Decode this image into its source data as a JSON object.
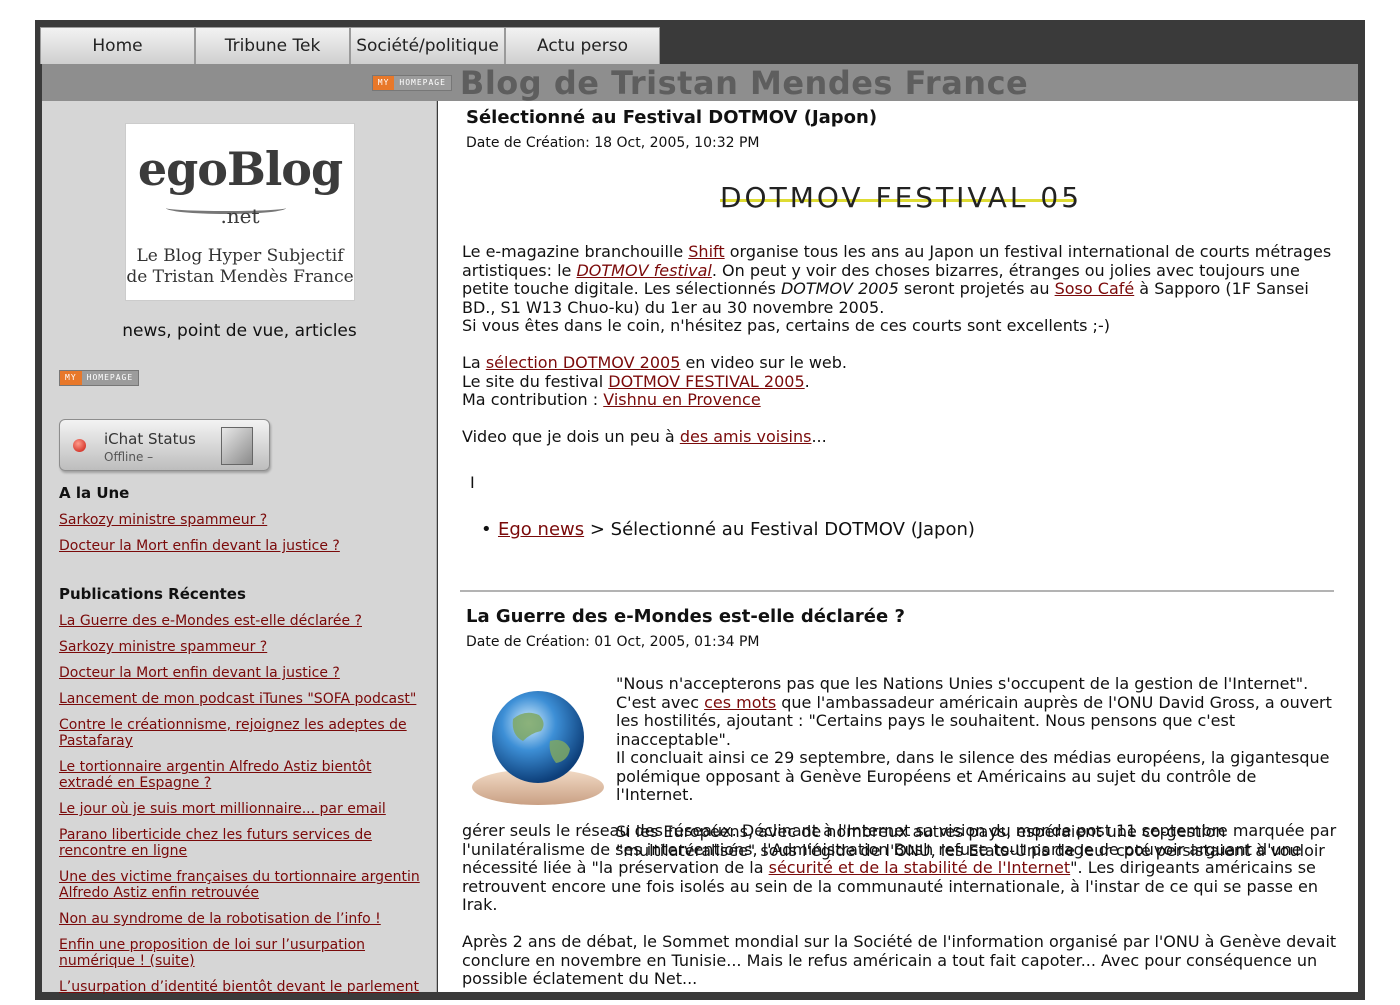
{
  "tabs": [
    "Home",
    "Tribune Tek",
    "Société/politique",
    "Actu perso"
  ],
  "banner": {
    "badge_my": "MY",
    "badge_hp": "HOMEPAGE",
    "title": "Blog de Tristan Mendes France"
  },
  "sidebar": {
    "logo": {
      "ego": "egoBlog",
      "net": ".net",
      "line1": "Le Blog Hyper Subjectif",
      "line2": "de Tristan Mendès France"
    },
    "tagline": "news, point de vue, articles",
    "badge_my": "MY",
    "badge_hp": "HOMEPAGE",
    "ichat": {
      "title": "iChat Status",
      "status": "Offline –"
    },
    "une": {
      "heading": "A la Une",
      "items": [
        "Sarkozy ministre spammeur ?",
        "Docteur la Mort enfin devant la justice ?"
      ]
    },
    "recent": {
      "heading": "Publications Récentes",
      "items": [
        "La Guerre des e-Mondes est-elle déclarée ?",
        "Sarkozy ministre spammeur ?",
        "Docteur la Mort enfin devant la justice ?",
        "Lancement de mon podcast iTunes \"SOFA podcast\"",
        "Contre le créationnisme, rejoignez les adeptes de Pastafaray",
        "Le tortionnaire argentin Alfredo Astiz bientôt extradé en Espagne ?",
        "Le jour où je suis mort millionnaire... par email",
        "Parano liberticide chez les futurs services de rencontre en ligne",
        "Une des victime françaises du tortionnaire argentin Alfredo Astiz enfin retrouvée",
        "Non au syndrome de la robotisation de l’info !",
        "Enfin une proposition de loi sur l’usurpation numérique ! (suite)",
        "L’usurpation d’identité bientôt devant le parlement"
      ]
    }
  },
  "post1": {
    "title": "Sélectionné au Festival DOTMOV (Japon)",
    "date": "Date de Création: 18 Oct, 2005, 10:32 PM",
    "logo_text": "DOTMOV FESTIVAL 05",
    "p1a": "Le e-magazine branchouille ",
    "p1_link1": "Shift",
    "p1b": " organise tous les ans au Japon un festival international de courts métrages artistiques: le ",
    "p1_link2": "DOTMOV festival",
    "p1c": ". On peut y voir des choses bizarres, étranges ou jolies avec toujours une petite touche digitale. Les sélectionnés ",
    "p1_em": "DOTMOV 2005",
    "p1d": " seront projetés au ",
    "p1_link3": "Soso Café",
    "p1e": " à Sapporo (1F Sansei BD., S1 W13 Chuo-ku) du 1er au 30 novembre 2005.",
    "p2": "Si vous êtes dans le coin, n'hésitez pas, certains de ces courts sont excellents ;-)",
    "p3a": "La ",
    "p3_link": "sélection DOTMOV 2005",
    "p3b": " en video sur le web.",
    "p4a": "Le site du festival ",
    "p4_link": "DOTMOV FESTIVAL 2005",
    "p4b": ".",
    "p5a": "Ma contribution : ",
    "p5_link": "Vishnu en Provence",
    "p6a": "Video que je dois un peu à ",
    "p6_link": "des amis voisins",
    "p6b": "...",
    "cursor": "I",
    "crumb_link": "Ego news",
    "crumb_rest": " > Sélectionné au Festival DOTMOV (Japon)"
  },
  "post2": {
    "title": "La Guerre des e-Mondes est-elle déclarée ?",
    "date": "Date de Création: 01 Oct, 2005, 01:34 PM",
    "f1a": "\"Nous n'accepterons pas que les Nations Unies s'occupent de la gestion de l'Internet\". C'est avec ",
    "f1_link": "ces mots",
    "f1b": " que l'ambassadeur américain auprès de l'ONU David Gross, a ouvert les hostilités, ajoutant : \"Certains pays le souhaitent. Nous pensons que c'est inacceptable\".",
    "f2": "Il concluait ainsi ce 29 septembre, dans le silence des médias européens, la gigantesque polémique opposant à Genève Européens et Américains au sujet du contrôle de l'Internet.",
    "f3": "Si les Européens, avec de nombreux autres pays, espéraient une co-gestion \"multilatéralisée\" sous l'égide de l'ONU, les Etats-Unis de leur coté persistaient à vouloir",
    "w1": "gérer seuls le réseau des réseaux. Déclinant à l'Internet sa vision du monde post 11 septembre marquée par l'unilatéralisme de ses interventions, l'Administration Bush refuse tout partage de pouvoir arguant d'une nécessité liée à \"la préservation de la ",
    "w1_link": "sécurité et de la stabilité de l'Internet",
    "w1b": "\". Les dirigeants américains se retrouvent encore une fois isolés au sein de la communauté internationale, à l'instar de ce qui se passe en Irak.",
    "w2": "Après 2 ans de débat, le Sommet mondial sur la Société de l'information organisé par l'ONU à Genève devait conclure en novembre en Tunisie... Mais le refus américain a tout fait capoter... Avec pour conséquence un possible éclatement du Net..."
  }
}
